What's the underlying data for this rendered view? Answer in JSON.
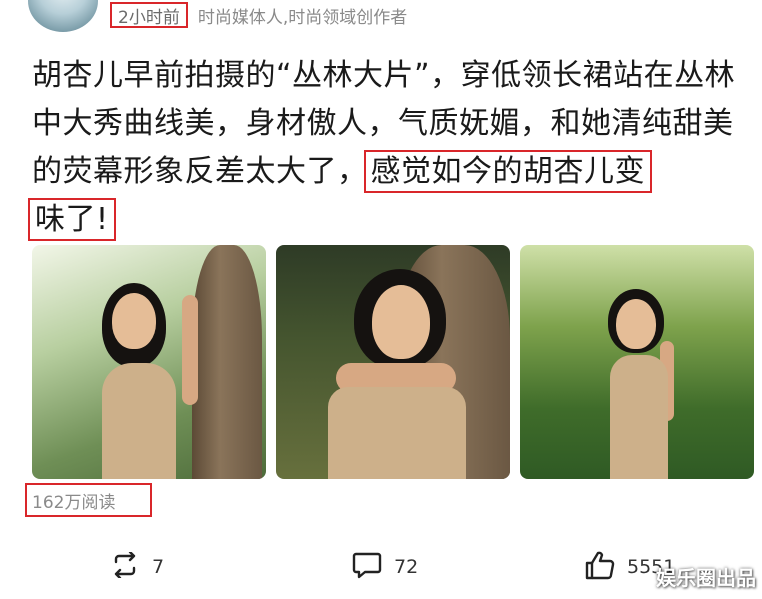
{
  "post": {
    "time": "2小时前",
    "author_desc": "时尚媒体人,时尚领域创作者",
    "text_main": "胡杏儿早前拍摄的“丛林大片”，穿低领长裙站在丛林中大秀曲线美，身材傲人，气质妩媚，和她清纯甜美的荧幕形象反差太大了，",
    "text_highlight_1": "感觉如今的胡杏儿变",
    "text_highlight_2": "味了!",
    "read_count": "162万阅读"
  },
  "actions": {
    "repost": {
      "icon": "repost-icon",
      "count": "7"
    },
    "comment": {
      "icon": "comment-icon",
      "count": "72"
    },
    "like": {
      "icon": "thumbs-up-icon",
      "count": "5551"
    }
  },
  "watermark": "娱乐圈出品",
  "colors": {
    "highlight_border": "#d9262a",
    "meta_text": "#8a8a8a"
  }
}
